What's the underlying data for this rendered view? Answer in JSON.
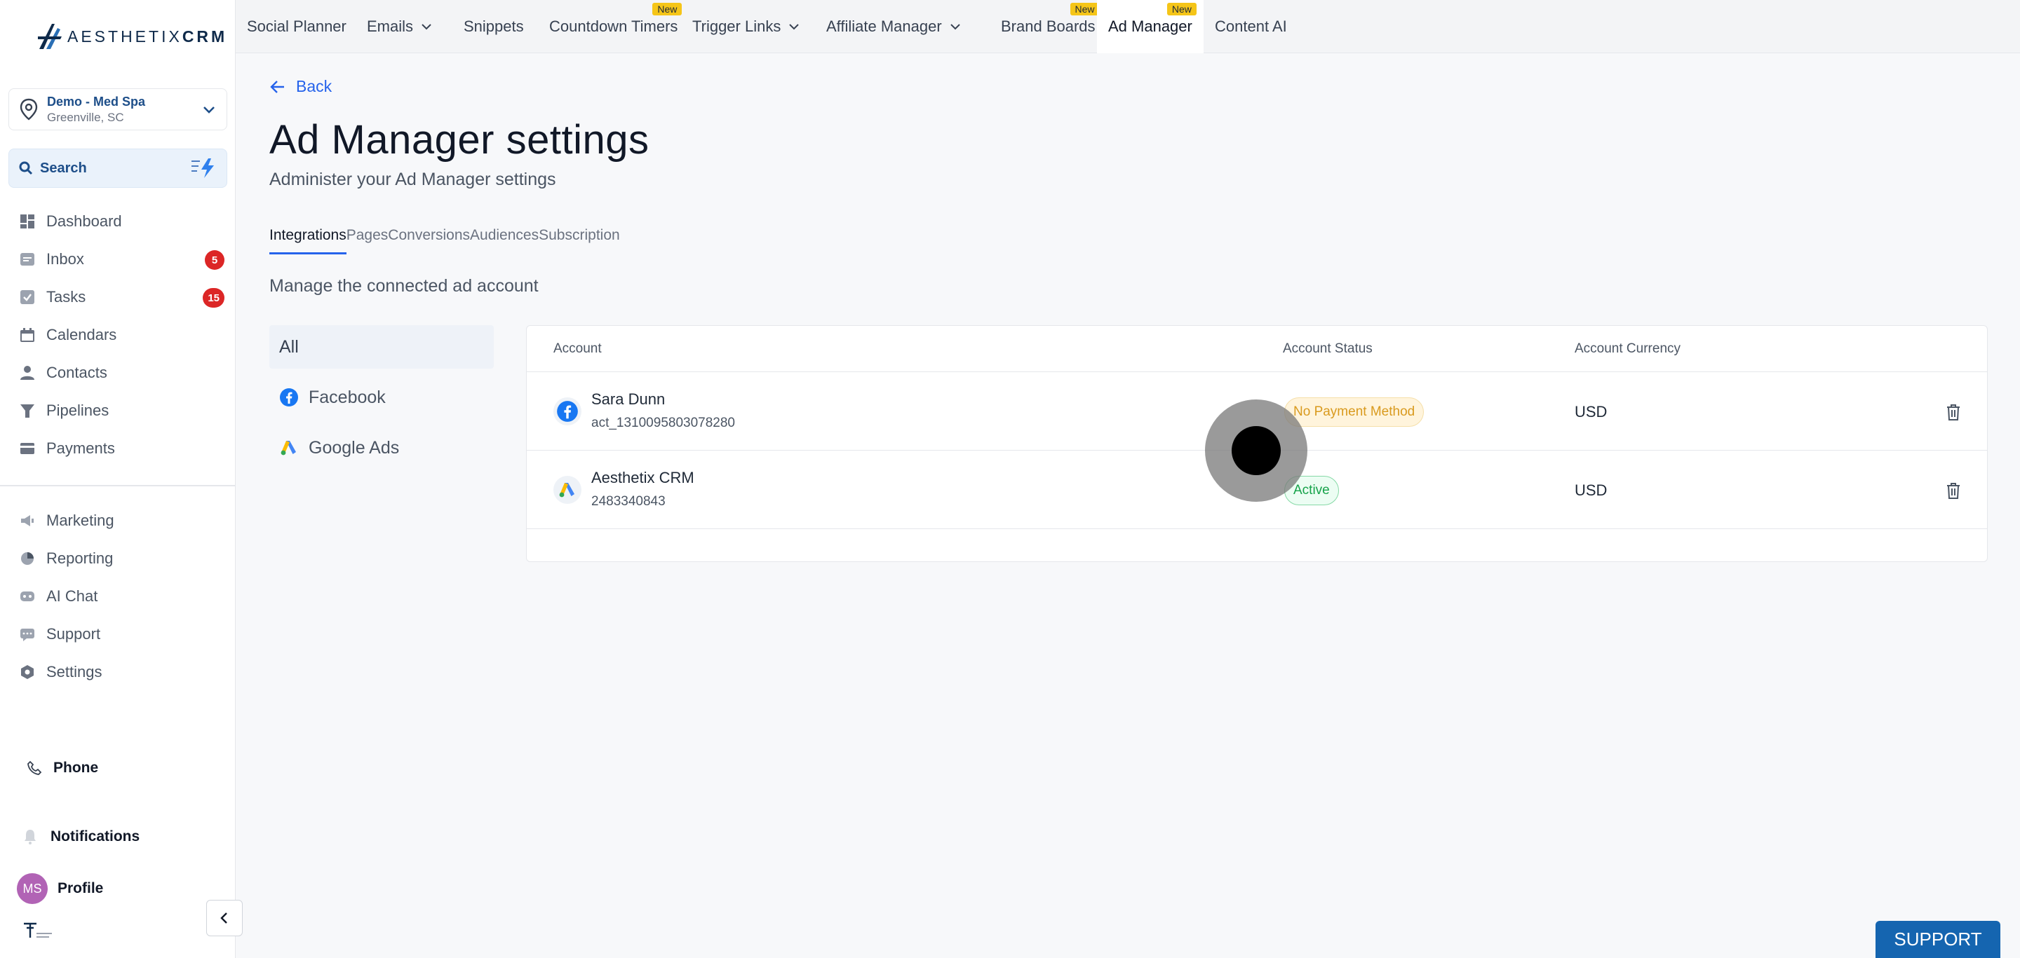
{
  "brand": {
    "name_light": "AESTHETIX",
    "name_bold": "CRM"
  },
  "location": {
    "name": "Demo - Med Spa",
    "city": "Greenville, SC"
  },
  "search": {
    "label": "Search"
  },
  "sidebar": {
    "items": [
      {
        "label": "Dashboard",
        "icon": "dashboard-icon"
      },
      {
        "label": "Inbox",
        "icon": "inbox-icon",
        "badge": "5"
      },
      {
        "label": "Tasks",
        "icon": "tasks-icon",
        "badge": "15"
      },
      {
        "label": "Calendars",
        "icon": "calendar-icon"
      },
      {
        "label": "Contacts",
        "icon": "contacts-icon"
      },
      {
        "label": "Pipelines",
        "icon": "pipelines-icon"
      },
      {
        "label": "Payments",
        "icon": "payments-icon"
      }
    ],
    "items2": [
      {
        "label": "Marketing",
        "icon": "marketing-icon"
      },
      {
        "label": "Reporting",
        "icon": "reporting-icon"
      },
      {
        "label": "AI Chat",
        "icon": "ai-chat-icon"
      },
      {
        "label": "Support",
        "icon": "support-icon"
      },
      {
        "label": "Settings",
        "icon": "settings-icon"
      }
    ],
    "phone": "Phone",
    "notifications": "Notifications",
    "profile": {
      "initials": "MS",
      "label": "Profile"
    }
  },
  "topnav": {
    "tabs": [
      {
        "label": "Social Planner"
      },
      {
        "label": "Emails"
      },
      {
        "label": "Snippets"
      },
      {
        "label": "Countdown Timers",
        "badge": "New"
      },
      {
        "label": "Trigger Links"
      },
      {
        "label": "Affiliate Manager"
      },
      {
        "label": "Brand Boards",
        "badge": "New"
      },
      {
        "label": "Ad Manager",
        "badge": "New"
      },
      {
        "label": "Content AI"
      }
    ]
  },
  "main": {
    "back": "Back",
    "title": "Ad Manager settings",
    "subtitle": "Administer your Ad Manager settings",
    "subtabs": [
      "Integrations",
      "Pages",
      "Conversions",
      "Audiences",
      "Subscription"
    ],
    "section_label": "Manage the connected ad account",
    "filters": [
      "All",
      "Facebook",
      "Google Ads"
    ],
    "table": {
      "headers": [
        "Account",
        "Account Status",
        "Account Currency"
      ],
      "rows": [
        {
          "name": "Sara Dunn",
          "id": "act_1310095803078280",
          "status": "No Payment Method",
          "currency": "USD",
          "platform": "facebook"
        },
        {
          "name": "Aesthetix CRM",
          "id": "2483340843",
          "status": "Active",
          "currency": "USD",
          "platform": "google-ads"
        }
      ]
    }
  },
  "support_button": "SUPPORT",
  "colors": {
    "accent": "#2563eb",
    "badge_red": "#dc2626",
    "new_badge": "#f5c518",
    "support": "#1565b0"
  }
}
